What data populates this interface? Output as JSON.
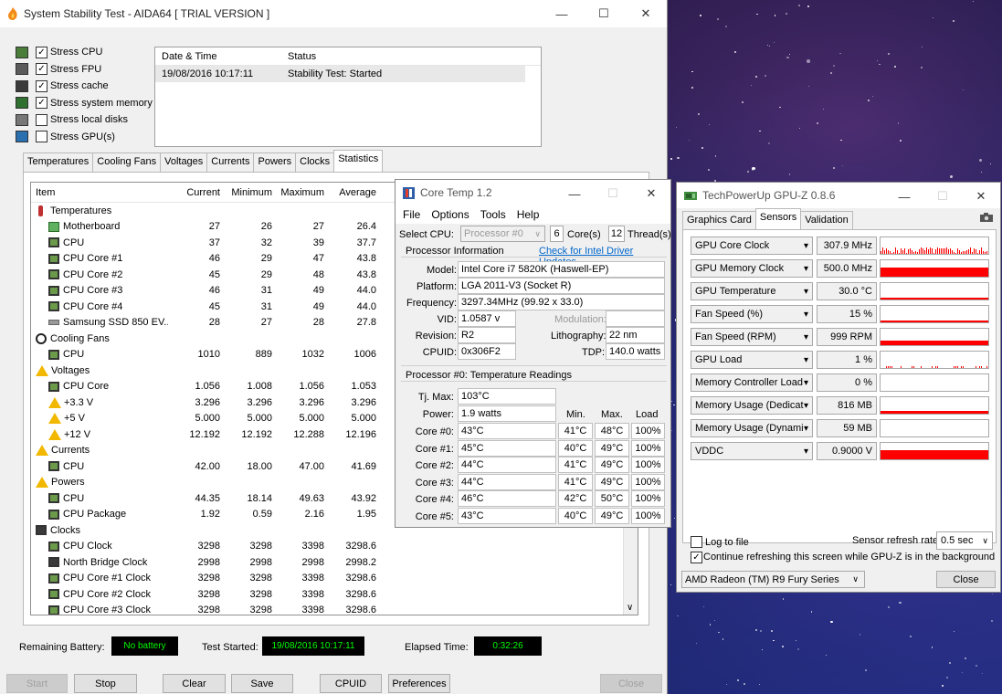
{
  "aida": {
    "title": "System Stability Test - AIDA64  [ TRIAL VERSION ]",
    "stress": [
      {
        "label": "Stress CPU",
        "checked": true
      },
      {
        "label": "Stress FPU",
        "checked": true
      },
      {
        "label": "Stress cache",
        "checked": true
      },
      {
        "label": "Stress system memory",
        "checked": true
      },
      {
        "label": "Stress local disks",
        "checked": false
      },
      {
        "label": "Stress GPU(s)",
        "checked": false
      }
    ],
    "status_headers": {
      "datetime": "Date & Time",
      "status": "Status"
    },
    "status_row": {
      "datetime": "19/08/2016 10:17:11",
      "status": "Stability Test: Started"
    },
    "tabs": [
      "Temperatures",
      "Cooling Fans",
      "Voltages",
      "Currents",
      "Powers",
      "Clocks",
      "Statistics"
    ],
    "active_tab": "Statistics",
    "stat_headers": [
      "Item",
      "Current",
      "Minimum",
      "Maximum",
      "Average"
    ],
    "stat_rows": [
      {
        "item": "Temperatures",
        "icon": "thermometer-icon",
        "indent": 0,
        "group": true,
        "v": [
          "",
          "",
          "",
          ""
        ]
      },
      {
        "item": "Motherboard",
        "icon": "motherboard-icon",
        "indent": 1,
        "v": [
          "27",
          "26",
          "27",
          "26.4"
        ]
      },
      {
        "item": "CPU",
        "icon": "chip-icon",
        "indent": 1,
        "v": [
          "37",
          "32",
          "39",
          "37.7"
        ]
      },
      {
        "item": "CPU Core #1",
        "icon": "chip-icon",
        "indent": 1,
        "v": [
          "46",
          "29",
          "47",
          "43.8"
        ]
      },
      {
        "item": "CPU Core #2",
        "icon": "chip-icon",
        "indent": 1,
        "v": [
          "45",
          "29",
          "48",
          "43.8"
        ]
      },
      {
        "item": "CPU Core #3",
        "icon": "chip-icon",
        "indent": 1,
        "v": [
          "46",
          "31",
          "49",
          "44.0"
        ]
      },
      {
        "item": "CPU Core #4",
        "icon": "chip-icon",
        "indent": 1,
        "v": [
          "45",
          "31",
          "49",
          "44.0"
        ]
      },
      {
        "item": "Samsung SSD 850 EV...",
        "icon": "disk-icon",
        "indent": 1,
        "v": [
          "28",
          "27",
          "28",
          "27.8"
        ]
      },
      {
        "item": "Cooling Fans",
        "icon": "fan-icon",
        "indent": 0,
        "group": true,
        "v": [
          "",
          "",
          "",
          ""
        ]
      },
      {
        "item": "CPU",
        "icon": "chip-icon",
        "indent": 1,
        "v": [
          "1010",
          "889",
          "1032",
          "1006"
        ]
      },
      {
        "item": "Voltages",
        "icon": "warning-icon",
        "indent": 0,
        "group": true,
        "v": [
          "",
          "",
          "",
          ""
        ]
      },
      {
        "item": "CPU Core",
        "icon": "chip-icon",
        "indent": 1,
        "v": [
          "1.056",
          "1.008",
          "1.056",
          "1.053"
        ]
      },
      {
        "item": "+3.3 V",
        "icon": "warning-icon",
        "indent": 1,
        "v": [
          "3.296",
          "3.296",
          "3.296",
          "3.296"
        ]
      },
      {
        "item": "+5 V",
        "icon": "warning-icon",
        "indent": 1,
        "v": [
          "5.000",
          "5.000",
          "5.000",
          "5.000"
        ]
      },
      {
        "item": "+12 V",
        "icon": "warning-icon",
        "indent": 1,
        "v": [
          "12.192",
          "12.192",
          "12.288",
          "12.196"
        ]
      },
      {
        "item": "Currents",
        "icon": "warning-icon",
        "indent": 0,
        "group": true,
        "v": [
          "",
          "",
          "",
          ""
        ]
      },
      {
        "item": "CPU",
        "icon": "chip-icon",
        "indent": 1,
        "v": [
          "42.00",
          "18.00",
          "47.00",
          "41.69"
        ]
      },
      {
        "item": "Powers",
        "icon": "warning-icon",
        "indent": 0,
        "group": true,
        "v": [
          "",
          "",
          "",
          ""
        ]
      },
      {
        "item": "CPU",
        "icon": "chip-icon",
        "indent": 1,
        "v": [
          "44.35",
          "18.14",
          "49.63",
          "43.92"
        ]
      },
      {
        "item": "CPU Package",
        "icon": "chip-icon",
        "indent": 1,
        "v": [
          "1.92",
          "0.59",
          "2.16",
          "1.95"
        ]
      },
      {
        "item": "Clocks",
        "icon": "clock-chip-icon",
        "indent": 0,
        "group": true,
        "v": [
          "",
          "",
          "",
          ""
        ]
      },
      {
        "item": "CPU Clock",
        "icon": "chip-icon",
        "indent": 1,
        "v": [
          "3298",
          "3298",
          "3398",
          "3298.6"
        ]
      },
      {
        "item": "North Bridge Clock",
        "icon": "clock-chip-icon",
        "indent": 1,
        "v": [
          "2998",
          "2998",
          "2998",
          "2998.2"
        ]
      },
      {
        "item": "CPU Core #1 Clock",
        "icon": "chip-icon",
        "indent": 1,
        "v": [
          "3298",
          "3298",
          "3398",
          "3298.6"
        ]
      },
      {
        "item": "CPU Core #2 Clock",
        "icon": "chip-icon",
        "indent": 1,
        "v": [
          "3298",
          "3298",
          "3398",
          "3298.6"
        ]
      },
      {
        "item": "CPU Core #3 Clock",
        "icon": "chip-icon",
        "indent": 1,
        "v": [
          "3298",
          "3298",
          "3398",
          "3298.6"
        ]
      }
    ],
    "bottom": {
      "battery_label": "Remaining Battery:",
      "battery_value": "No battery",
      "started_label": "Test Started:",
      "started_value": "19/08/2016 10:17:11",
      "elapsed_label": "Elapsed Time:",
      "elapsed_value": "0:32:26"
    },
    "buttons": {
      "start": "Start",
      "stop": "Stop",
      "clear": "Clear",
      "save": "Save",
      "cpuid": "CPUID",
      "preferences": "Preferences",
      "close": "Close"
    }
  },
  "coretemp": {
    "title": "Core Temp 1.2",
    "menu": [
      "File",
      "Options",
      "Tools",
      "Help"
    ],
    "select_cpu_label": "Select CPU:",
    "select_cpu_value": "Processor #0",
    "cores_value": "6",
    "cores_label": "Core(s)",
    "threads_value": "12",
    "threads_label": "Thread(s)",
    "proc_info_label": "Processor Information",
    "driver_link": "Check for Intel Driver Updates",
    "model_label": "Model:",
    "model": "Intel Core i7 5820K (Haswell-EP)",
    "platform_label": "Platform:",
    "platform": "LGA 2011-V3 (Socket R)",
    "frequency_label": "Frequency:",
    "frequency": "3297.34MHz (99.92 x 33.0)",
    "vid_label": "VID:",
    "vid": "1.0587 v",
    "modulation_label": "Modulation:",
    "revision_label": "Revision:",
    "revision": "R2",
    "lithography_label": "Lithography:",
    "lithography": "22 nm",
    "cpuid_label": "CPUID:",
    "cpuid": "0x306F2",
    "tdp_label": "TDP:",
    "tdp": "140.0 watts",
    "temp_group_label": "Processor #0: Temperature Readings",
    "tjmax_label": "Tj. Max:",
    "tjmax": "103°C",
    "power_label": "Power:",
    "power": "1.9 watts",
    "col_min": "Min.",
    "col_max": "Max.",
    "col_load": "Load",
    "cores": [
      {
        "label": "Core #0:",
        "temp": "43°C",
        "min": "41°C",
        "max": "48°C",
        "load": "100%"
      },
      {
        "label": "Core #1:",
        "temp": "45°C",
        "min": "40°C",
        "max": "49°C",
        "load": "100%"
      },
      {
        "label": "Core #2:",
        "temp": "44°C",
        "min": "41°C",
        "max": "49°C",
        "load": "100%"
      },
      {
        "label": "Core #3:",
        "temp": "44°C",
        "min": "41°C",
        "max": "49°C",
        "load": "100%"
      },
      {
        "label": "Core #4:",
        "temp": "46°C",
        "min": "42°C",
        "max": "50°C",
        "load": "100%"
      },
      {
        "label": "Core #5:",
        "temp": "43°C",
        "min": "40°C",
        "max": "49°C",
        "load": "100%"
      }
    ]
  },
  "gpuz": {
    "title": "TechPowerUp GPU-Z 0.8.6",
    "tabs": [
      "Graphics Card",
      "Sensors",
      "Validation"
    ],
    "active_tab": "Sensors",
    "sensors": [
      {
        "name": "GPU Core Clock",
        "value": "307.9 MHz",
        "fill": 0.25,
        "style": "spiky"
      },
      {
        "name": "GPU Memory Clock",
        "value": "500.0 MHz",
        "fill": 0.5,
        "style": "flat"
      },
      {
        "name": "GPU Temperature",
        "value": "30.0 °C",
        "fill": 0.1,
        "style": "line"
      },
      {
        "name": "Fan Speed (%)",
        "value": "15 %",
        "fill": 0.1,
        "style": "line"
      },
      {
        "name": "Fan Speed (RPM)",
        "value": "999 RPM",
        "fill": 0.25,
        "style": "flat"
      },
      {
        "name": "GPU Load",
        "value": "1 %",
        "fill": 0.05,
        "style": "dots"
      },
      {
        "name": "Memory Controller Load",
        "value": "0 %",
        "fill": 0.0,
        "style": "none"
      },
      {
        "name": "Memory Usage (Dedicated)",
        "value": "816 MB",
        "fill": 0.15,
        "style": "flat"
      },
      {
        "name": "Memory Usage (Dynamic)",
        "value": "59 MB",
        "fill": 0.0,
        "style": "none"
      },
      {
        "name": "VDDC",
        "value": "0.9000 V",
        "fill": 0.5,
        "style": "flat"
      }
    ],
    "log_label": "Log to file",
    "log_checked": false,
    "refresh_label": "Sensor refresh rate:",
    "refresh_value": "0.5 sec",
    "continue_label": "Continue refreshing this screen while GPU-Z is in the background",
    "continue_checked": true,
    "card_select": "AMD Radeon (TM) R9 Fury Series",
    "close_button": "Close"
  }
}
